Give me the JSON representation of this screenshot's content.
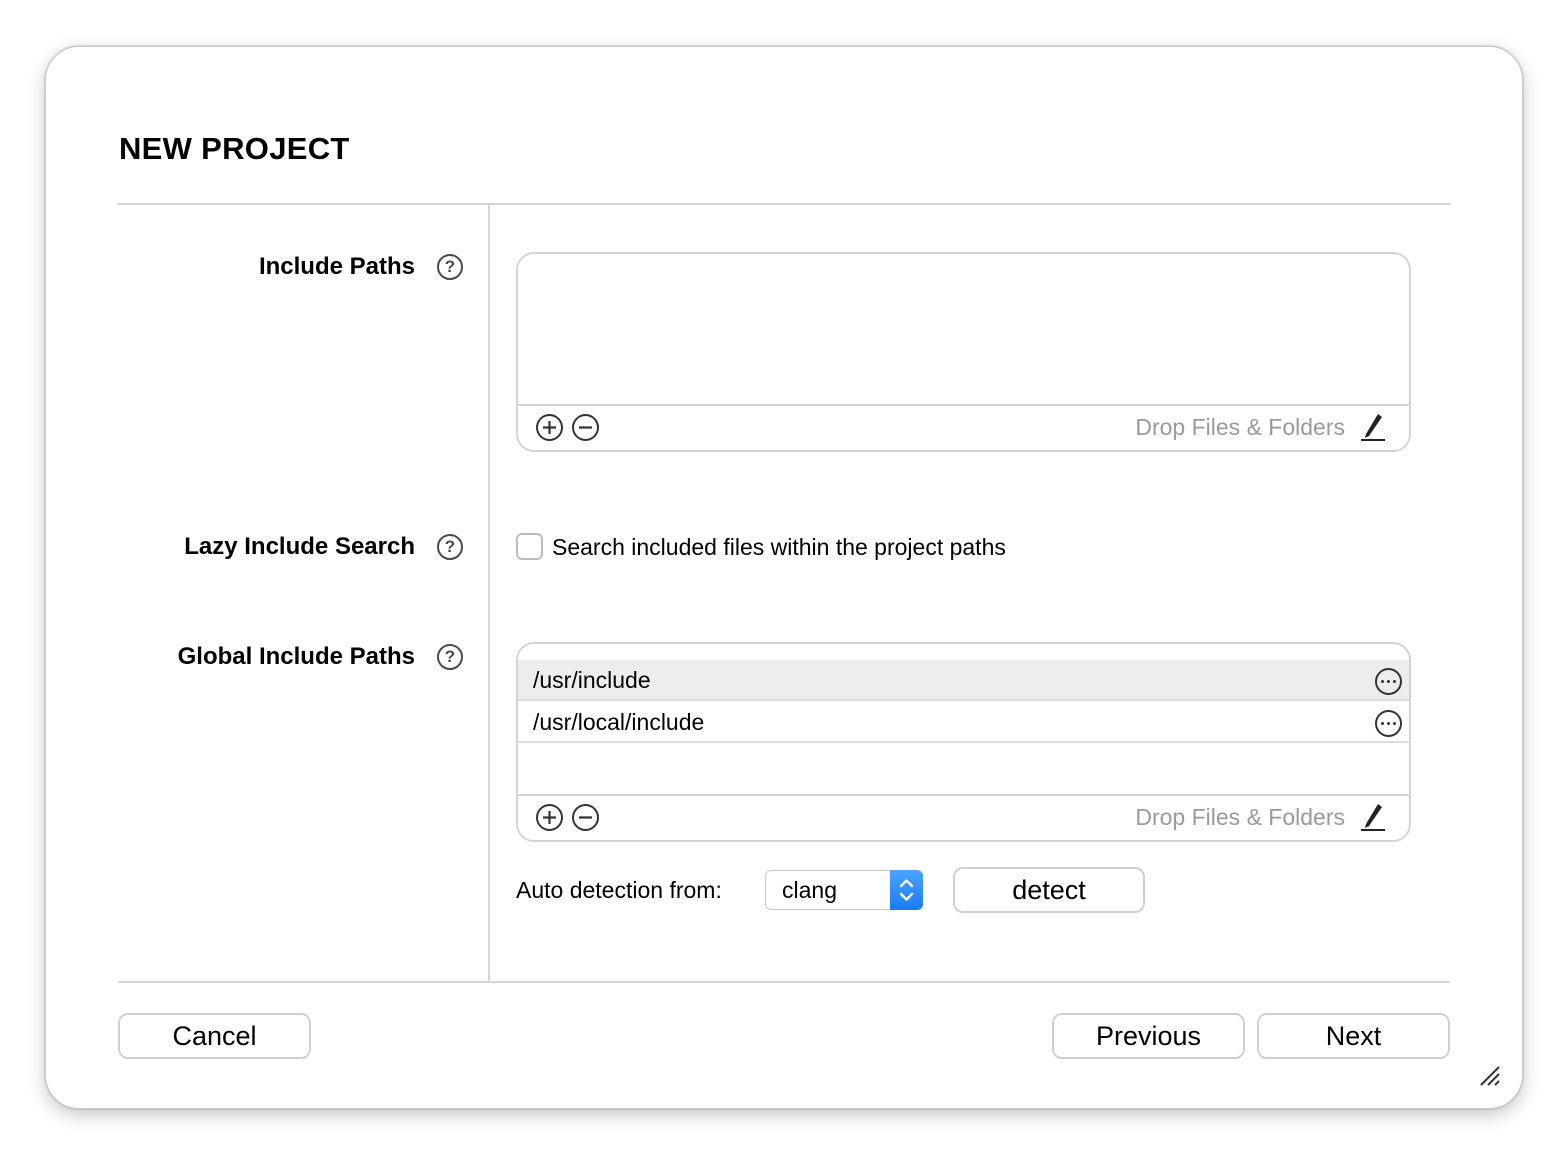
{
  "dialog": {
    "title": "NEW PROJECT"
  },
  "include_paths": {
    "label": "Include Paths",
    "items": [],
    "drop_hint": "Drop Files & Folders"
  },
  "lazy_include_search": {
    "label": "Lazy Include Search",
    "checkbox_label": "Search included files within the project paths",
    "checked": false
  },
  "global_include_paths": {
    "label": "Global Include Paths",
    "items": [
      "/usr/include",
      "/usr/local/include"
    ],
    "drop_hint": "Drop Files & Folders"
  },
  "auto_detection": {
    "label": "Auto detection from:",
    "selected": "clang",
    "button_label": "detect"
  },
  "footer": {
    "cancel_label": "Cancel",
    "previous_label": "Previous",
    "next_label": "Next"
  },
  "colors": {
    "accent": "#1a7cf5",
    "border": "#d4d4d4",
    "hint_text": "#9a9a9a"
  }
}
